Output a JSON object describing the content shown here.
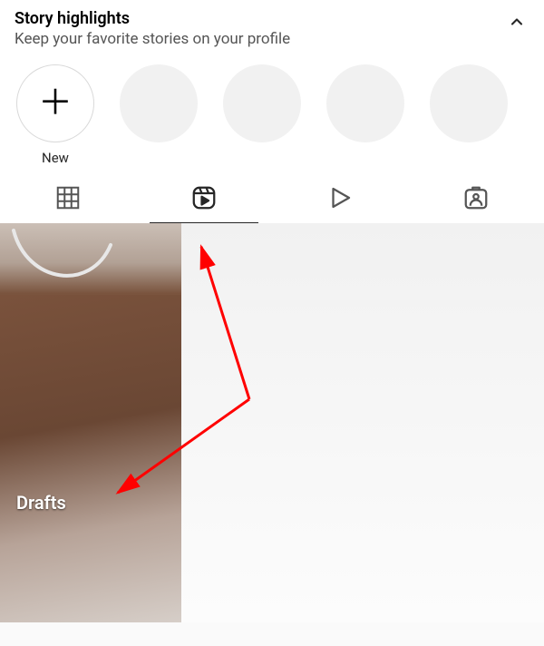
{
  "highlights": {
    "title": "Story highlights",
    "subtitle": "Keep your favorite stories on your profile",
    "new_label": "New"
  },
  "tabs": {
    "grid": "grid-icon",
    "reels": "reels-icon",
    "video": "play-outline-icon",
    "tagged": "tagged-icon",
    "active": "reels"
  },
  "drafts": {
    "label": "Drafts"
  },
  "annotation": {
    "color": "#ff0000"
  }
}
